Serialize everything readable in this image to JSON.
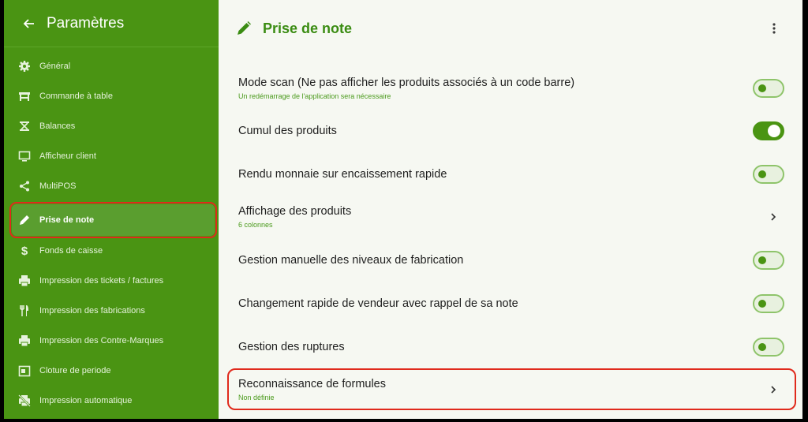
{
  "sidebar": {
    "title": "Paramètres",
    "items": [
      {
        "label": "Général",
        "icon": "gear-icon"
      },
      {
        "label": "Commande à table",
        "icon": "table-icon"
      },
      {
        "label": "Balances",
        "icon": "scale-icon"
      },
      {
        "label": "Afficheur client",
        "icon": "monitor-icon"
      },
      {
        "label": "MultiPOS",
        "icon": "share-icon"
      },
      {
        "label": "Prise de note",
        "icon": "pencil-icon"
      },
      {
        "label": "Fonds de caisse",
        "icon": "dollar-icon"
      },
      {
        "label": "Impression des tickets / factures",
        "icon": "printer-icon"
      },
      {
        "label": "Impression des fabrications",
        "icon": "fork-knife-icon"
      },
      {
        "label": "Impression des Contre-Marques",
        "icon": "printer-icon"
      },
      {
        "label": "Cloture de periode",
        "icon": "calendar-icon"
      },
      {
        "label": "Impression automatique",
        "icon": "printer-off-icon"
      }
    ]
  },
  "main": {
    "title": "Prise de note",
    "settings": [
      {
        "title": "Mode scan (Ne pas afficher les produits associés à un code barre)",
        "subtitle": "Un redémarrage de l'application sera nécessaire",
        "control": "toggle",
        "on": false
      },
      {
        "title": "Cumul des produits",
        "control": "toggle",
        "on": true
      },
      {
        "title": "Rendu monnaie sur encaissement rapide",
        "control": "toggle",
        "on": false
      },
      {
        "title": "Affichage des produits",
        "subtitle": "6 colonnes",
        "control": "chevron"
      },
      {
        "title": "Gestion manuelle des niveaux de fabrication",
        "control": "toggle",
        "on": false
      },
      {
        "title": "Changement rapide de vendeur avec rappel de sa note",
        "control": "toggle",
        "on": false
      },
      {
        "title": "Gestion des ruptures",
        "control": "toggle",
        "on": false
      },
      {
        "title": "Reconnaissance de formules",
        "subtitle": "Non définie",
        "control": "chevron"
      }
    ]
  },
  "colors": {
    "brand": "#4a9413",
    "highlight": "#e02a1c",
    "background": "#f6f8f2"
  }
}
